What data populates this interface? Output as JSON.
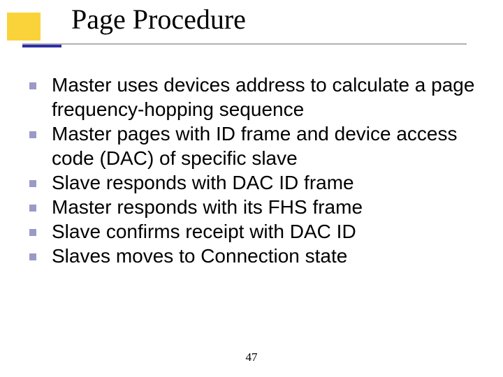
{
  "title": "Page Procedure",
  "bullets": {
    "b0": "Master uses devices address to calculate a page frequency-hopping sequence",
    "b1": "Master pages with ID frame and device access code (DAC) of specific slave",
    "b2": "Slave responds with DAC ID frame",
    "b3": "Master responds with its FHS frame",
    "b4": "Slave confirms receipt with DAC ID",
    "b5": "Slaves moves to Connection state"
  },
  "page_number": "47"
}
